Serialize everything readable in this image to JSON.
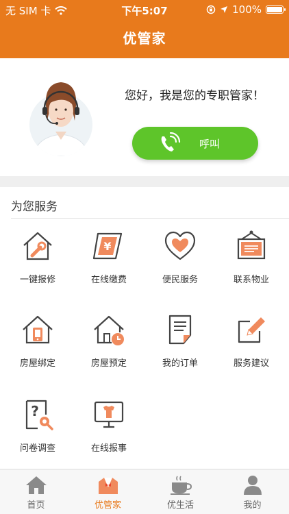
{
  "status_bar": {
    "carrier": "无 SIM 卡",
    "time": "下午5:07",
    "battery": "100%"
  },
  "nav": {
    "title": "优管家"
  },
  "hero": {
    "greeting": "您好，我是您的专职管家！",
    "call_label": "呼叫"
  },
  "services": {
    "title": "为您服务",
    "items": [
      {
        "label": "一键报修",
        "icon": "house-wrench-icon"
      },
      {
        "label": "在线缴费",
        "icon": "yuan-bill-icon"
      },
      {
        "label": "便民服务",
        "icon": "heart-icon"
      },
      {
        "label": "联系物业",
        "icon": "notice-board-icon"
      },
      {
        "label": "房屋绑定",
        "icon": "house-phone-icon"
      },
      {
        "label": "房屋预定",
        "icon": "house-clock-icon"
      },
      {
        "label": "我的订单",
        "icon": "document-icon"
      },
      {
        "label": "服务建议",
        "icon": "edit-icon"
      },
      {
        "label": "问卷调查",
        "icon": "survey-icon"
      },
      {
        "label": "在线报事",
        "icon": "monitor-report-icon"
      }
    ]
  },
  "tabs": [
    {
      "label": "首页",
      "icon": "home-icon",
      "active": false
    },
    {
      "label": "优管家",
      "icon": "butler-icon",
      "active": true
    },
    {
      "label": "优生活",
      "icon": "coffee-cup-icon",
      "active": false
    },
    {
      "label": "我的",
      "icon": "person-icon",
      "active": false
    }
  ],
  "colors": {
    "brand_orange": "#e87a1c",
    "call_green": "#5ec52a",
    "icon_accent": "#f08a5d",
    "icon_stroke": "#444444"
  }
}
